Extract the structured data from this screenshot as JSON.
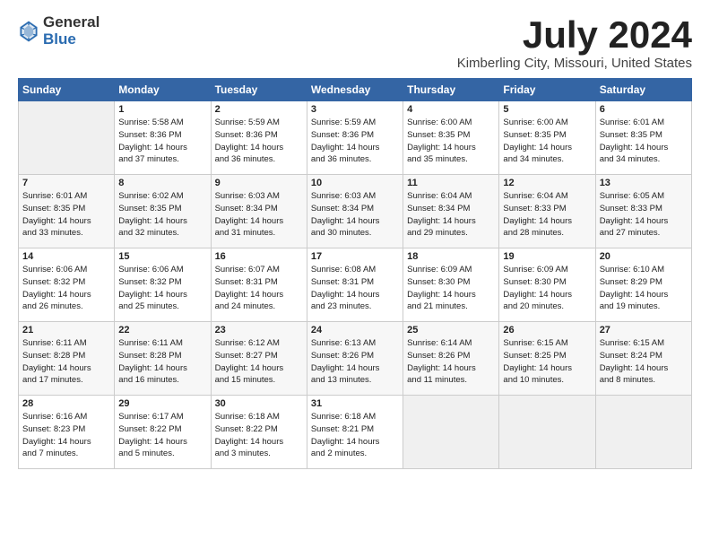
{
  "header": {
    "logo_general": "General",
    "logo_blue": "Blue",
    "month": "July 2024",
    "location": "Kimberling City, Missouri, United States"
  },
  "weekdays": [
    "Sunday",
    "Monday",
    "Tuesday",
    "Wednesday",
    "Thursday",
    "Friday",
    "Saturday"
  ],
  "weeks": [
    [
      {
        "day": "",
        "info": ""
      },
      {
        "day": "1",
        "info": "Sunrise: 5:58 AM\nSunset: 8:36 PM\nDaylight: 14 hours\nand 37 minutes."
      },
      {
        "day": "2",
        "info": "Sunrise: 5:59 AM\nSunset: 8:36 PM\nDaylight: 14 hours\nand 36 minutes."
      },
      {
        "day": "3",
        "info": "Sunrise: 5:59 AM\nSunset: 8:36 PM\nDaylight: 14 hours\nand 36 minutes."
      },
      {
        "day": "4",
        "info": "Sunrise: 6:00 AM\nSunset: 8:35 PM\nDaylight: 14 hours\nand 35 minutes."
      },
      {
        "day": "5",
        "info": "Sunrise: 6:00 AM\nSunset: 8:35 PM\nDaylight: 14 hours\nand 34 minutes."
      },
      {
        "day": "6",
        "info": "Sunrise: 6:01 AM\nSunset: 8:35 PM\nDaylight: 14 hours\nand 34 minutes."
      }
    ],
    [
      {
        "day": "7",
        "info": "Sunrise: 6:01 AM\nSunset: 8:35 PM\nDaylight: 14 hours\nand 33 minutes."
      },
      {
        "day": "8",
        "info": "Sunrise: 6:02 AM\nSunset: 8:35 PM\nDaylight: 14 hours\nand 32 minutes."
      },
      {
        "day": "9",
        "info": "Sunrise: 6:03 AM\nSunset: 8:34 PM\nDaylight: 14 hours\nand 31 minutes."
      },
      {
        "day": "10",
        "info": "Sunrise: 6:03 AM\nSunset: 8:34 PM\nDaylight: 14 hours\nand 30 minutes."
      },
      {
        "day": "11",
        "info": "Sunrise: 6:04 AM\nSunset: 8:34 PM\nDaylight: 14 hours\nand 29 minutes."
      },
      {
        "day": "12",
        "info": "Sunrise: 6:04 AM\nSunset: 8:33 PM\nDaylight: 14 hours\nand 28 minutes."
      },
      {
        "day": "13",
        "info": "Sunrise: 6:05 AM\nSunset: 8:33 PM\nDaylight: 14 hours\nand 27 minutes."
      }
    ],
    [
      {
        "day": "14",
        "info": "Sunrise: 6:06 AM\nSunset: 8:32 PM\nDaylight: 14 hours\nand 26 minutes."
      },
      {
        "day": "15",
        "info": "Sunrise: 6:06 AM\nSunset: 8:32 PM\nDaylight: 14 hours\nand 25 minutes."
      },
      {
        "day": "16",
        "info": "Sunrise: 6:07 AM\nSunset: 8:31 PM\nDaylight: 14 hours\nand 24 minutes."
      },
      {
        "day": "17",
        "info": "Sunrise: 6:08 AM\nSunset: 8:31 PM\nDaylight: 14 hours\nand 23 minutes."
      },
      {
        "day": "18",
        "info": "Sunrise: 6:09 AM\nSunset: 8:30 PM\nDaylight: 14 hours\nand 21 minutes."
      },
      {
        "day": "19",
        "info": "Sunrise: 6:09 AM\nSunset: 8:30 PM\nDaylight: 14 hours\nand 20 minutes."
      },
      {
        "day": "20",
        "info": "Sunrise: 6:10 AM\nSunset: 8:29 PM\nDaylight: 14 hours\nand 19 minutes."
      }
    ],
    [
      {
        "day": "21",
        "info": "Sunrise: 6:11 AM\nSunset: 8:28 PM\nDaylight: 14 hours\nand 17 minutes."
      },
      {
        "day": "22",
        "info": "Sunrise: 6:11 AM\nSunset: 8:28 PM\nDaylight: 14 hours\nand 16 minutes."
      },
      {
        "day": "23",
        "info": "Sunrise: 6:12 AM\nSunset: 8:27 PM\nDaylight: 14 hours\nand 15 minutes."
      },
      {
        "day": "24",
        "info": "Sunrise: 6:13 AM\nSunset: 8:26 PM\nDaylight: 14 hours\nand 13 minutes."
      },
      {
        "day": "25",
        "info": "Sunrise: 6:14 AM\nSunset: 8:26 PM\nDaylight: 14 hours\nand 11 minutes."
      },
      {
        "day": "26",
        "info": "Sunrise: 6:15 AM\nSunset: 8:25 PM\nDaylight: 14 hours\nand 10 minutes."
      },
      {
        "day": "27",
        "info": "Sunrise: 6:15 AM\nSunset: 8:24 PM\nDaylight: 14 hours\nand 8 minutes."
      }
    ],
    [
      {
        "day": "28",
        "info": "Sunrise: 6:16 AM\nSunset: 8:23 PM\nDaylight: 14 hours\nand 7 minutes."
      },
      {
        "day": "29",
        "info": "Sunrise: 6:17 AM\nSunset: 8:22 PM\nDaylight: 14 hours\nand 5 minutes."
      },
      {
        "day": "30",
        "info": "Sunrise: 6:18 AM\nSunset: 8:22 PM\nDaylight: 14 hours\nand 3 minutes."
      },
      {
        "day": "31",
        "info": "Sunrise: 6:18 AM\nSunset: 8:21 PM\nDaylight: 14 hours\nand 2 minutes."
      },
      {
        "day": "",
        "info": ""
      },
      {
        "day": "",
        "info": ""
      },
      {
        "day": "",
        "info": ""
      }
    ]
  ]
}
